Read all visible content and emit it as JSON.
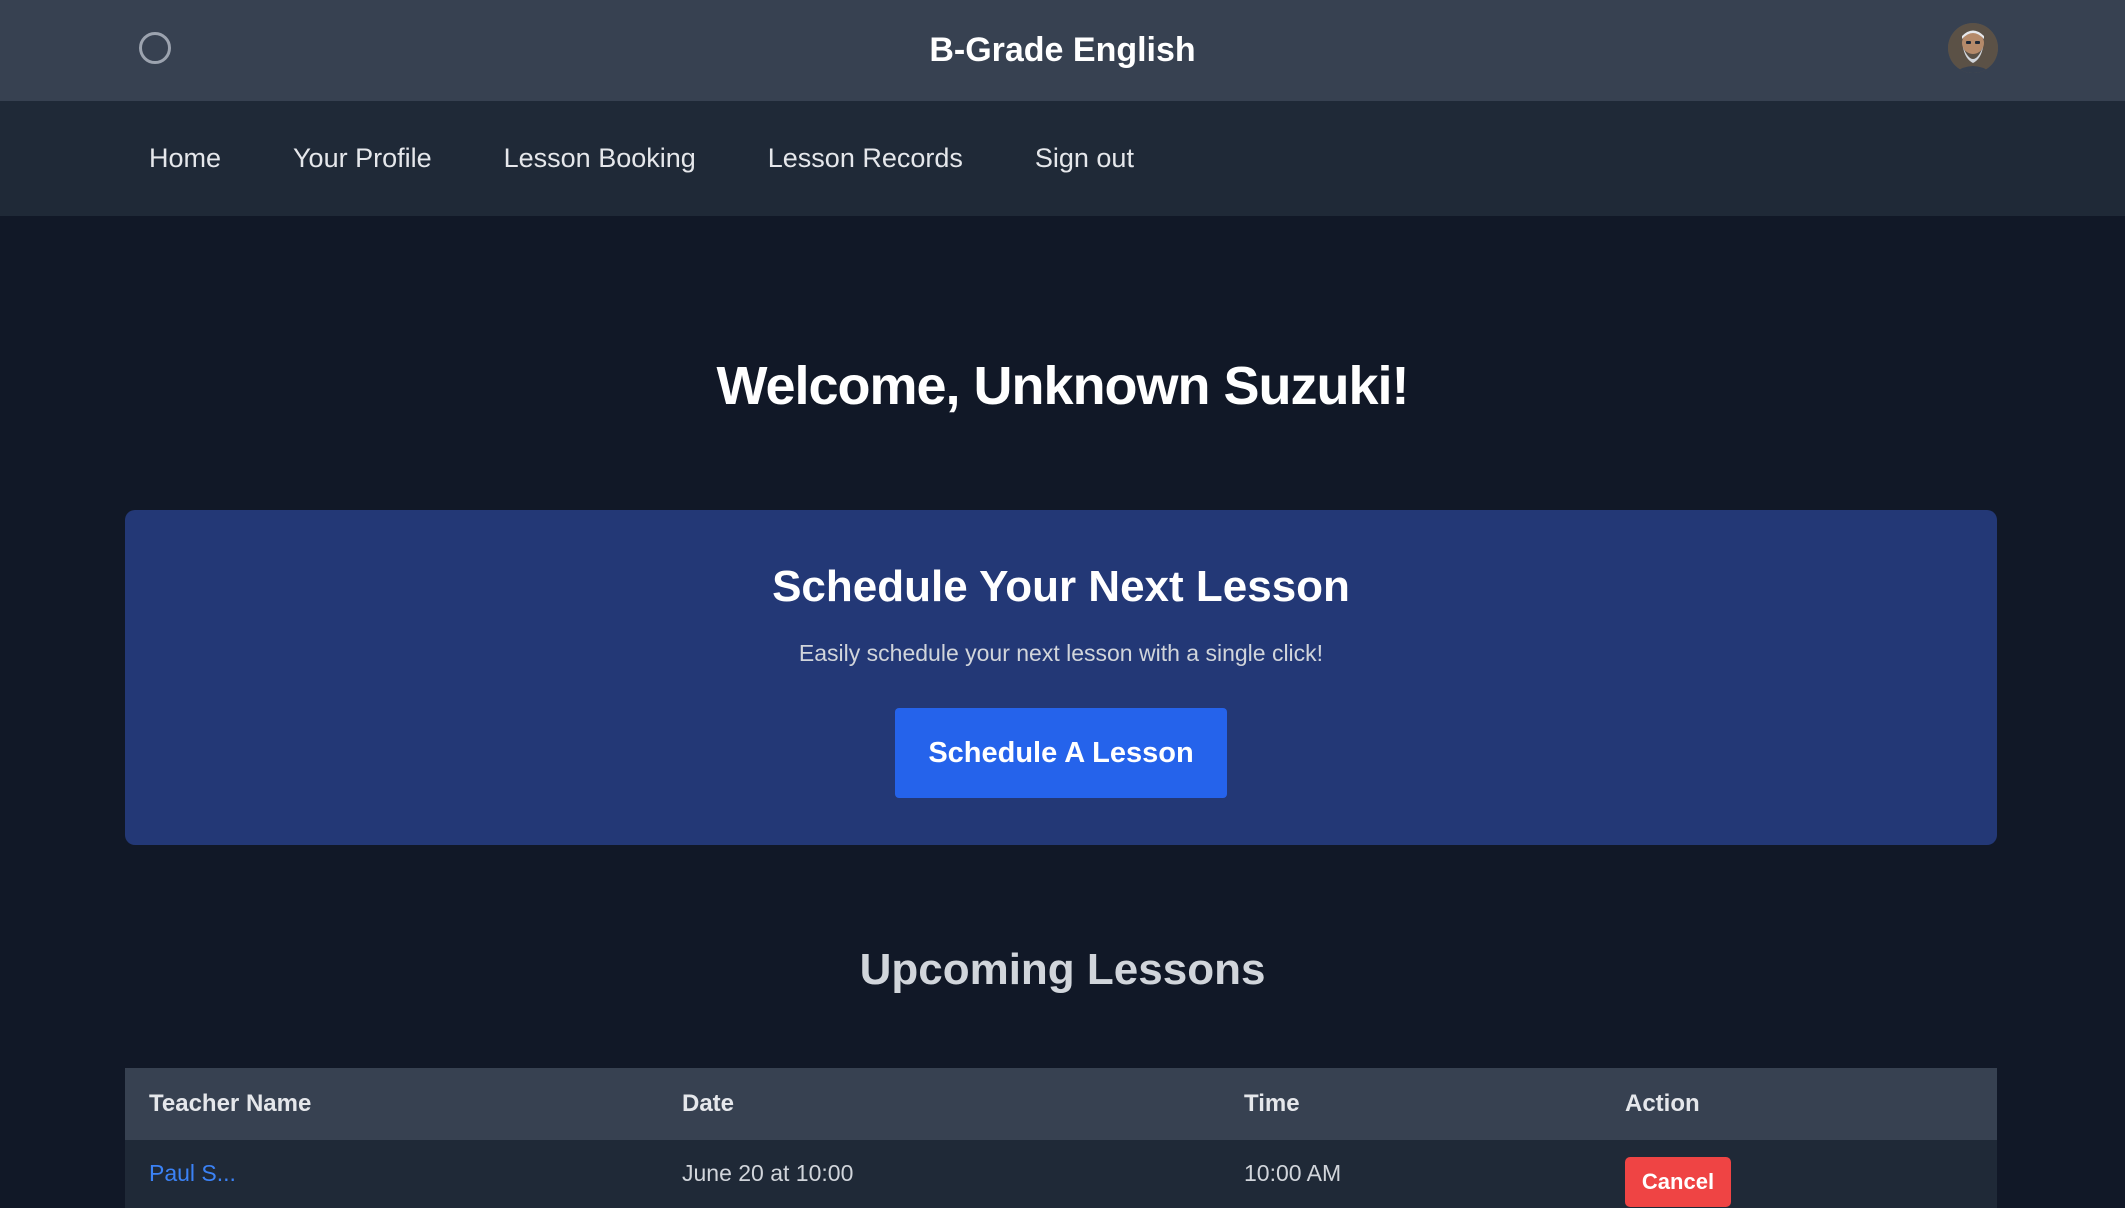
{
  "header": {
    "brand": "B-Grade English",
    "left_icon": "circle-icon",
    "avatar_icon": "user-avatar"
  },
  "nav": {
    "items": [
      {
        "label": "Home"
      },
      {
        "label": "Your Profile"
      },
      {
        "label": "Lesson Booking"
      },
      {
        "label": "Lesson Records"
      },
      {
        "label": "Sign out"
      }
    ]
  },
  "main": {
    "welcome": "Welcome, Unknown Suzuki!",
    "schedule_card": {
      "title": "Schedule Your Next Lesson",
      "subtitle": "Easily schedule your next lesson with a single click!",
      "button_label": "Schedule A Lesson"
    },
    "upcoming": {
      "title": "Upcoming Lessons",
      "columns": [
        "Teacher Name",
        "Date",
        "Time",
        "Action"
      ],
      "rows": [
        {
          "teacher": "Paul S...",
          "date": "June 20 at 10:00",
          "time": "10:00 AM",
          "action": "Cancel"
        }
      ]
    }
  },
  "colors": {
    "topbar_bg": "#374151",
    "navbar_bg": "#1f2937",
    "page_bg": "#111827",
    "card_bg": "#233876",
    "primary_button": "#2563eb",
    "danger_button": "#ef4444",
    "link": "#3b82f6"
  }
}
